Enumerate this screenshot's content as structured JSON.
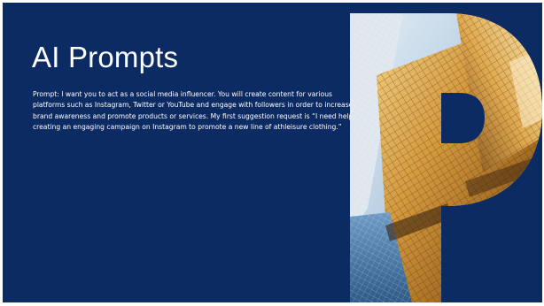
{
  "slide": {
    "title": "AI Prompts",
    "body": "Prompt: I want you to act as a social media influencer. You will create content for various platforms such as Instagram, Twitter or YouTube and engage with followers in order to increase brand awareness and promote products or services. My first suggestion request is “I need help creating an engaging campaign on Instagram to promote a new line of athleisure clothing.”",
    "background_color": "#0d2b63",
    "text_color": "#ffffff",
    "graphic": "skyscraper-photo-letter-p"
  }
}
